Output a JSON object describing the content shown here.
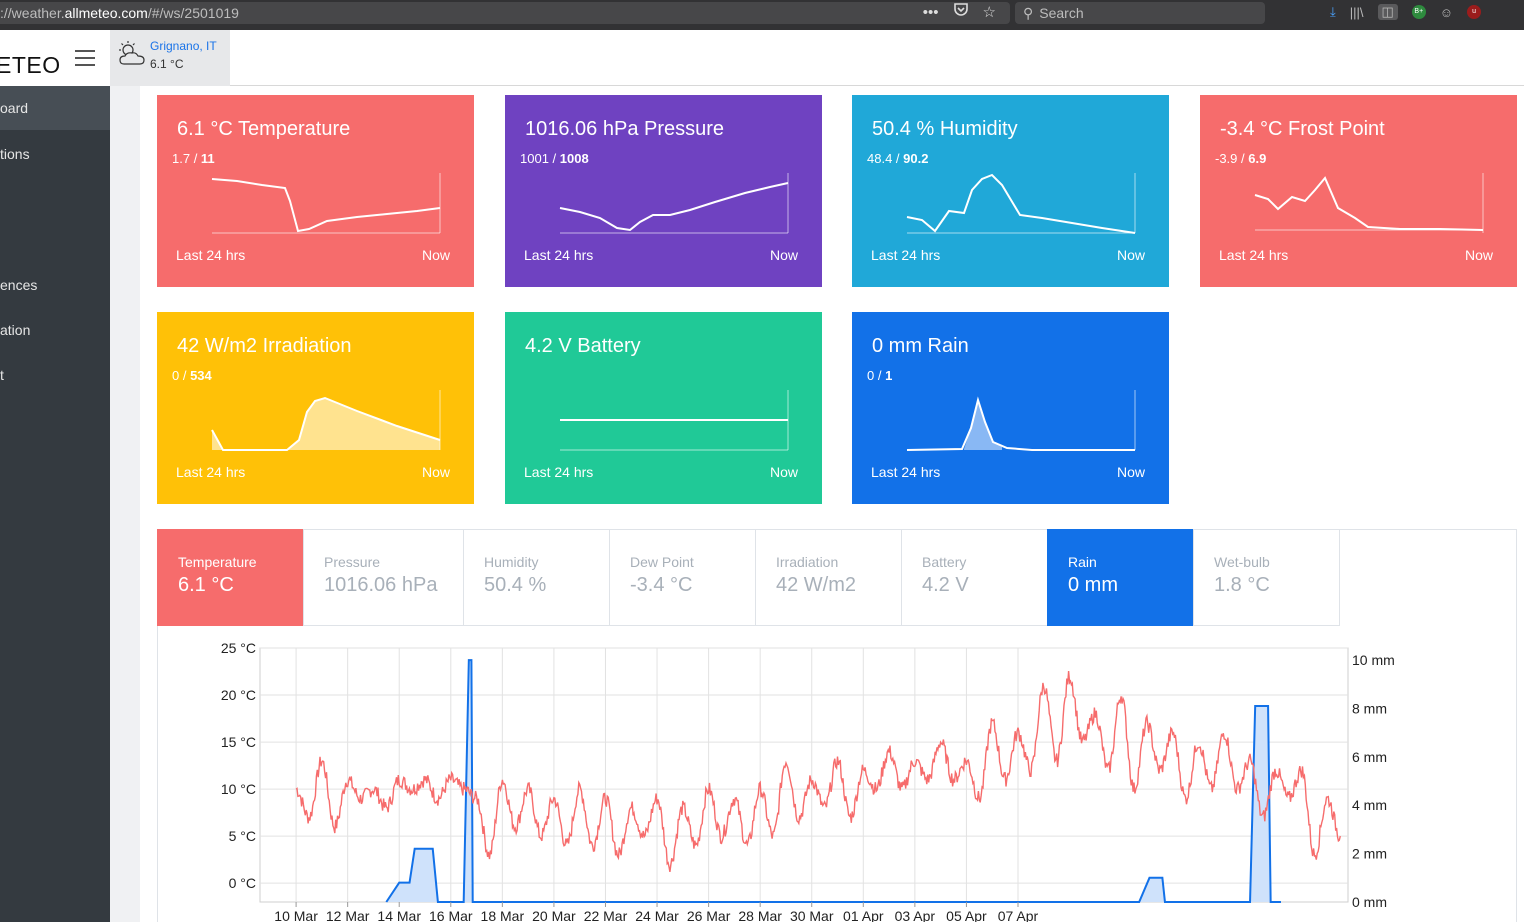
{
  "browser": {
    "url_prefix": "://weather.",
    "url_host": "allmeteo.com",
    "url_suffix": "/#/ws/2501019",
    "search_placeholder": "Search",
    "badge_green": "B+",
    "badge_red": "u"
  },
  "app": {
    "brand": "ETEO",
    "station_name": "Grignano, IT",
    "station_temp": "6.1 °C"
  },
  "sidebar": {
    "items": [
      {
        "label": "oard",
        "active": true
      },
      {
        "label": "tions",
        "active": false
      },
      {
        "label": "ences",
        "active": false
      },
      {
        "label": "ation",
        "active": false
      },
      {
        "label": "t",
        "active": false
      }
    ]
  },
  "cards": [
    {
      "title": "6.1 °C Temperature",
      "min": "1.7",
      "max": "11",
      "foot_left": "Last 24 hrs",
      "foot_right": "Now",
      "color": "#f66c6c"
    },
    {
      "title": "1016.06 hPa Pressure",
      "min": "1001",
      "max": "1008",
      "foot_left": "Last 24 hrs",
      "foot_right": "Now",
      "color": "#6f42c1"
    },
    {
      "title": "50.4 % Humidity",
      "min": "48.4",
      "max": "90.2",
      "foot_left": "Last 24 hrs",
      "foot_right": "Now",
      "color": "#20a8d8"
    },
    {
      "title": "-3.4 °C Frost Point",
      "min": "-3.9",
      "max": "6.9",
      "foot_left": "Last 24 hrs",
      "foot_right": "Now",
      "color": "#f66c6c"
    },
    {
      "title": "42 W/m2 Irradiation",
      "min": "0",
      "max": "534",
      "foot_left": "Last 24 hrs",
      "foot_right": "Now",
      "color": "#ffc107"
    },
    {
      "title": "4.2 V Battery",
      "min": "",
      "max": "",
      "foot_left": "Last 24 hrs",
      "foot_right": "Now",
      "color": "#20c997"
    },
    {
      "title": "0 mm Rain",
      "min": "0",
      "max": "1",
      "foot_left": "Last 24 hrs",
      "foot_right": "Now",
      "color": "#1271e8"
    }
  ],
  "tabs": [
    {
      "label": "Temperature",
      "value": "6.1 °C",
      "active": "red"
    },
    {
      "label": "Pressure",
      "value": "1016.06 hPa",
      "active": ""
    },
    {
      "label": "Humidity",
      "value": "50.4 %",
      "active": ""
    },
    {
      "label": "Dew Point",
      "value": "-3.4 °C",
      "active": ""
    },
    {
      "label": "Irradiation",
      "value": "42 W/m2",
      "active": ""
    },
    {
      "label": "Battery",
      "value": "4.2 V",
      "active": ""
    },
    {
      "label": "Rain",
      "value": "0 mm",
      "active": "blue"
    },
    {
      "label": "Wet-bulb",
      "value": "1.8 °C",
      "active": ""
    }
  ],
  "chart_data": {
    "type": "line",
    "x_ticks": [
      "10 Mar",
      "12 Mar",
      "14 Mar",
      "16 Mar",
      "18 Mar",
      "20 Mar",
      "22 Mar",
      "24 Mar",
      "26 Mar",
      "28 Mar",
      "30 Mar",
      "01 Apr",
      "03 Apr",
      "05 Apr",
      "07 Apr"
    ],
    "y_left_ticks": [
      "25 °C",
      "20 °C",
      "15 °C",
      "10 °C",
      "5 °C",
      "0 °C"
    ],
    "y_right_ticks": [
      "10 mm",
      "8 mm",
      "6 mm",
      "4 mm",
      "2 mm",
      "0 mm"
    ],
    "y_left_range": [
      -2,
      25
    ],
    "y_right_range": [
      0,
      10.5
    ],
    "grid": true,
    "series": [
      {
        "name": "Temperature",
        "axis": "left",
        "color": "#f66c6c",
        "x_days": [
          0,
          0.5,
          1,
          1.5,
          2,
          2.5,
          3,
          3.5,
          4,
          4.5,
          5,
          5.5,
          6,
          6.5,
          7,
          7.5,
          8,
          8.5,
          9,
          9.5,
          10,
          10.5,
          11,
          11.5,
          12,
          12.5,
          13,
          13.5,
          14,
          14.5,
          15,
          15.5,
          16,
          16.5,
          17,
          17.5,
          18,
          18.5,
          19,
          19.5,
          20,
          20.5,
          21,
          21.5,
          22,
          22.5,
          23,
          23.5,
          24,
          24.5,
          25,
          25.5,
          26,
          26.5,
          27,
          27.5,
          28,
          28.5,
          29,
          29.5,
          30,
          30.5,
          31,
          31.5,
          32,
          32.5,
          33,
          33.5,
          34,
          34.5,
          35,
          35.5,
          36,
          36.5,
          37,
          37.5,
          38,
          38.5,
          39,
          39.5,
          40,
          40.5
        ],
        "values": [
          10,
          7,
          13,
          6,
          11,
          9,
          10,
          8,
          11,
          10,
          11,
          9,
          11,
          10,
          9,
          3,
          11,
          6,
          10,
          5,
          9,
          4,
          10,
          4,
          9,
          3,
          8,
          5,
          9,
          2,
          8,
          4,
          10,
          5,
          9,
          4,
          10,
          5,
          13,
          7,
          11,
          8,
          13,
          7,
          12,
          10,
          14,
          10,
          13,
          11,
          15,
          11,
          13,
          9,
          17,
          11,
          16,
          12,
          21,
          13,
          22,
          15,
          18,
          12,
          20,
          10,
          17,
          12,
          16,
          9,
          15,
          10,
          16,
          10,
          13,
          7,
          12,
          9,
          12,
          3,
          9,
          5
        ]
      },
      {
        "name": "Rain",
        "axis": "right",
        "color": "#1271e8",
        "type": "area",
        "x_days": [
          3.5,
          4.0,
          4.4,
          4.6,
          5.3,
          5.5,
          5.6,
          6.4,
          6.5,
          6.7,
          6.8,
          6.85,
          32.7,
          33.1,
          33.6,
          33.7,
          36.8,
          37.0,
          37.2,
          37.7,
          37.8,
          38.2
        ],
        "values": [
          0,
          0.8,
          0.8,
          2.2,
          2.2,
          0,
          0,
          0,
          0,
          10,
          10,
          0,
          0,
          1,
          1,
          0,
          0,
          0,
          8.1,
          8.1,
          0,
          0
        ]
      }
    ]
  }
}
